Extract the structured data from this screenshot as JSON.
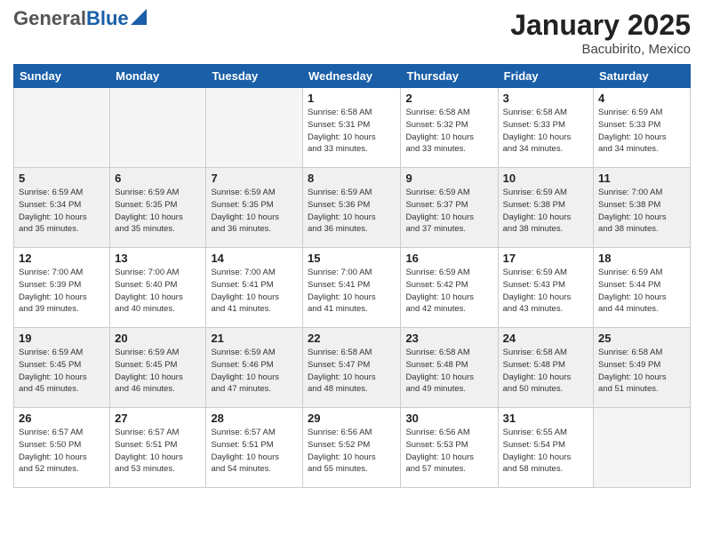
{
  "header": {
    "logo_general": "General",
    "logo_blue": "Blue",
    "month_title": "January 2025",
    "location": "Bacubirito, Mexico"
  },
  "weekdays": [
    "Sunday",
    "Monday",
    "Tuesday",
    "Wednesday",
    "Thursday",
    "Friday",
    "Saturday"
  ],
  "weeks": [
    [
      {
        "day": "",
        "empty": true
      },
      {
        "day": "",
        "empty": true
      },
      {
        "day": "",
        "empty": true
      },
      {
        "day": "1",
        "info": "Sunrise: 6:58 AM\nSunset: 5:31 PM\nDaylight: 10 hours\nand 33 minutes."
      },
      {
        "day": "2",
        "info": "Sunrise: 6:58 AM\nSunset: 5:32 PM\nDaylight: 10 hours\nand 33 minutes."
      },
      {
        "day": "3",
        "info": "Sunrise: 6:58 AM\nSunset: 5:33 PM\nDaylight: 10 hours\nand 34 minutes."
      },
      {
        "day": "4",
        "info": "Sunrise: 6:59 AM\nSunset: 5:33 PM\nDaylight: 10 hours\nand 34 minutes."
      }
    ],
    [
      {
        "day": "5",
        "info": "Sunrise: 6:59 AM\nSunset: 5:34 PM\nDaylight: 10 hours\nand 35 minutes."
      },
      {
        "day": "6",
        "info": "Sunrise: 6:59 AM\nSunset: 5:35 PM\nDaylight: 10 hours\nand 35 minutes."
      },
      {
        "day": "7",
        "info": "Sunrise: 6:59 AM\nSunset: 5:35 PM\nDaylight: 10 hours\nand 36 minutes."
      },
      {
        "day": "8",
        "info": "Sunrise: 6:59 AM\nSunset: 5:36 PM\nDaylight: 10 hours\nand 36 minutes."
      },
      {
        "day": "9",
        "info": "Sunrise: 6:59 AM\nSunset: 5:37 PM\nDaylight: 10 hours\nand 37 minutes."
      },
      {
        "day": "10",
        "info": "Sunrise: 6:59 AM\nSunset: 5:38 PM\nDaylight: 10 hours\nand 38 minutes."
      },
      {
        "day": "11",
        "info": "Sunrise: 7:00 AM\nSunset: 5:38 PM\nDaylight: 10 hours\nand 38 minutes."
      }
    ],
    [
      {
        "day": "12",
        "info": "Sunrise: 7:00 AM\nSunset: 5:39 PM\nDaylight: 10 hours\nand 39 minutes."
      },
      {
        "day": "13",
        "info": "Sunrise: 7:00 AM\nSunset: 5:40 PM\nDaylight: 10 hours\nand 40 minutes."
      },
      {
        "day": "14",
        "info": "Sunrise: 7:00 AM\nSunset: 5:41 PM\nDaylight: 10 hours\nand 41 minutes."
      },
      {
        "day": "15",
        "info": "Sunrise: 7:00 AM\nSunset: 5:41 PM\nDaylight: 10 hours\nand 41 minutes."
      },
      {
        "day": "16",
        "info": "Sunrise: 6:59 AM\nSunset: 5:42 PM\nDaylight: 10 hours\nand 42 minutes."
      },
      {
        "day": "17",
        "info": "Sunrise: 6:59 AM\nSunset: 5:43 PM\nDaylight: 10 hours\nand 43 minutes."
      },
      {
        "day": "18",
        "info": "Sunrise: 6:59 AM\nSunset: 5:44 PM\nDaylight: 10 hours\nand 44 minutes."
      }
    ],
    [
      {
        "day": "19",
        "info": "Sunrise: 6:59 AM\nSunset: 5:45 PM\nDaylight: 10 hours\nand 45 minutes."
      },
      {
        "day": "20",
        "info": "Sunrise: 6:59 AM\nSunset: 5:45 PM\nDaylight: 10 hours\nand 46 minutes."
      },
      {
        "day": "21",
        "info": "Sunrise: 6:59 AM\nSunset: 5:46 PM\nDaylight: 10 hours\nand 47 minutes."
      },
      {
        "day": "22",
        "info": "Sunrise: 6:58 AM\nSunset: 5:47 PM\nDaylight: 10 hours\nand 48 minutes."
      },
      {
        "day": "23",
        "info": "Sunrise: 6:58 AM\nSunset: 5:48 PM\nDaylight: 10 hours\nand 49 minutes."
      },
      {
        "day": "24",
        "info": "Sunrise: 6:58 AM\nSunset: 5:48 PM\nDaylight: 10 hours\nand 50 minutes."
      },
      {
        "day": "25",
        "info": "Sunrise: 6:58 AM\nSunset: 5:49 PM\nDaylight: 10 hours\nand 51 minutes."
      }
    ],
    [
      {
        "day": "26",
        "info": "Sunrise: 6:57 AM\nSunset: 5:50 PM\nDaylight: 10 hours\nand 52 minutes."
      },
      {
        "day": "27",
        "info": "Sunrise: 6:57 AM\nSunset: 5:51 PM\nDaylight: 10 hours\nand 53 minutes."
      },
      {
        "day": "28",
        "info": "Sunrise: 6:57 AM\nSunset: 5:51 PM\nDaylight: 10 hours\nand 54 minutes."
      },
      {
        "day": "29",
        "info": "Sunrise: 6:56 AM\nSunset: 5:52 PM\nDaylight: 10 hours\nand 55 minutes."
      },
      {
        "day": "30",
        "info": "Sunrise: 6:56 AM\nSunset: 5:53 PM\nDaylight: 10 hours\nand 57 minutes."
      },
      {
        "day": "31",
        "info": "Sunrise: 6:55 AM\nSunset: 5:54 PM\nDaylight: 10 hours\nand 58 minutes."
      },
      {
        "day": "",
        "empty": true
      }
    ]
  ]
}
